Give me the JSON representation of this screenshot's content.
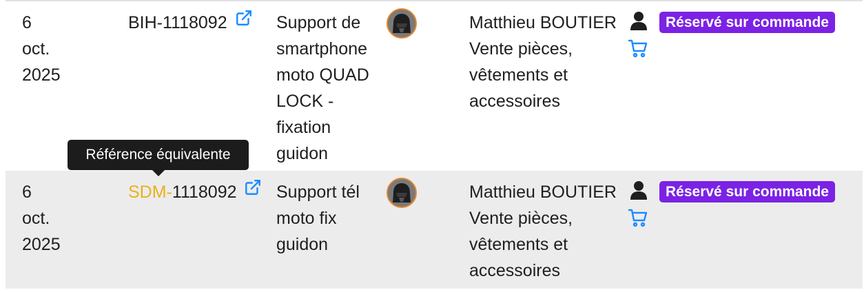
{
  "rows": [
    {
      "date": {
        "day": "6",
        "month": "oct.",
        "year": "2025"
      },
      "reference": {
        "prefix": "",
        "text": "BIH-1118092"
      },
      "description": [
        "Support de",
        "smartphone",
        "moto QUAD",
        "LOCK -",
        "fixation",
        "guidon"
      ],
      "seller": {
        "name": "Matthieu BOUTIER",
        "category": [
          "Vente pièces,",
          "vêtements et",
          "accessoires"
        ]
      },
      "status": "Réservé sur commande"
    },
    {
      "date": {
        "day": "6",
        "month": "oct.",
        "year": "2025"
      },
      "reference": {
        "prefix": "SDM-",
        "text": "1118092"
      },
      "description": [
        "Support tél",
        "moto fix",
        "guidon"
      ],
      "seller": {
        "name": "Matthieu BOUTIER",
        "category": [
          "Vente pièces,",
          "vêtements et",
          "accessoires"
        ]
      },
      "status": "Réservé sur commande"
    }
  ],
  "tooltip": "Référence équivalente",
  "colors": {
    "badge": "#7b22e4",
    "link": "#1a8cff",
    "prefix": "#e8b21a",
    "row_highlight": "#ececec"
  },
  "icons": [
    "external-link-icon",
    "avatar",
    "user-icon",
    "cart-icon"
  ]
}
